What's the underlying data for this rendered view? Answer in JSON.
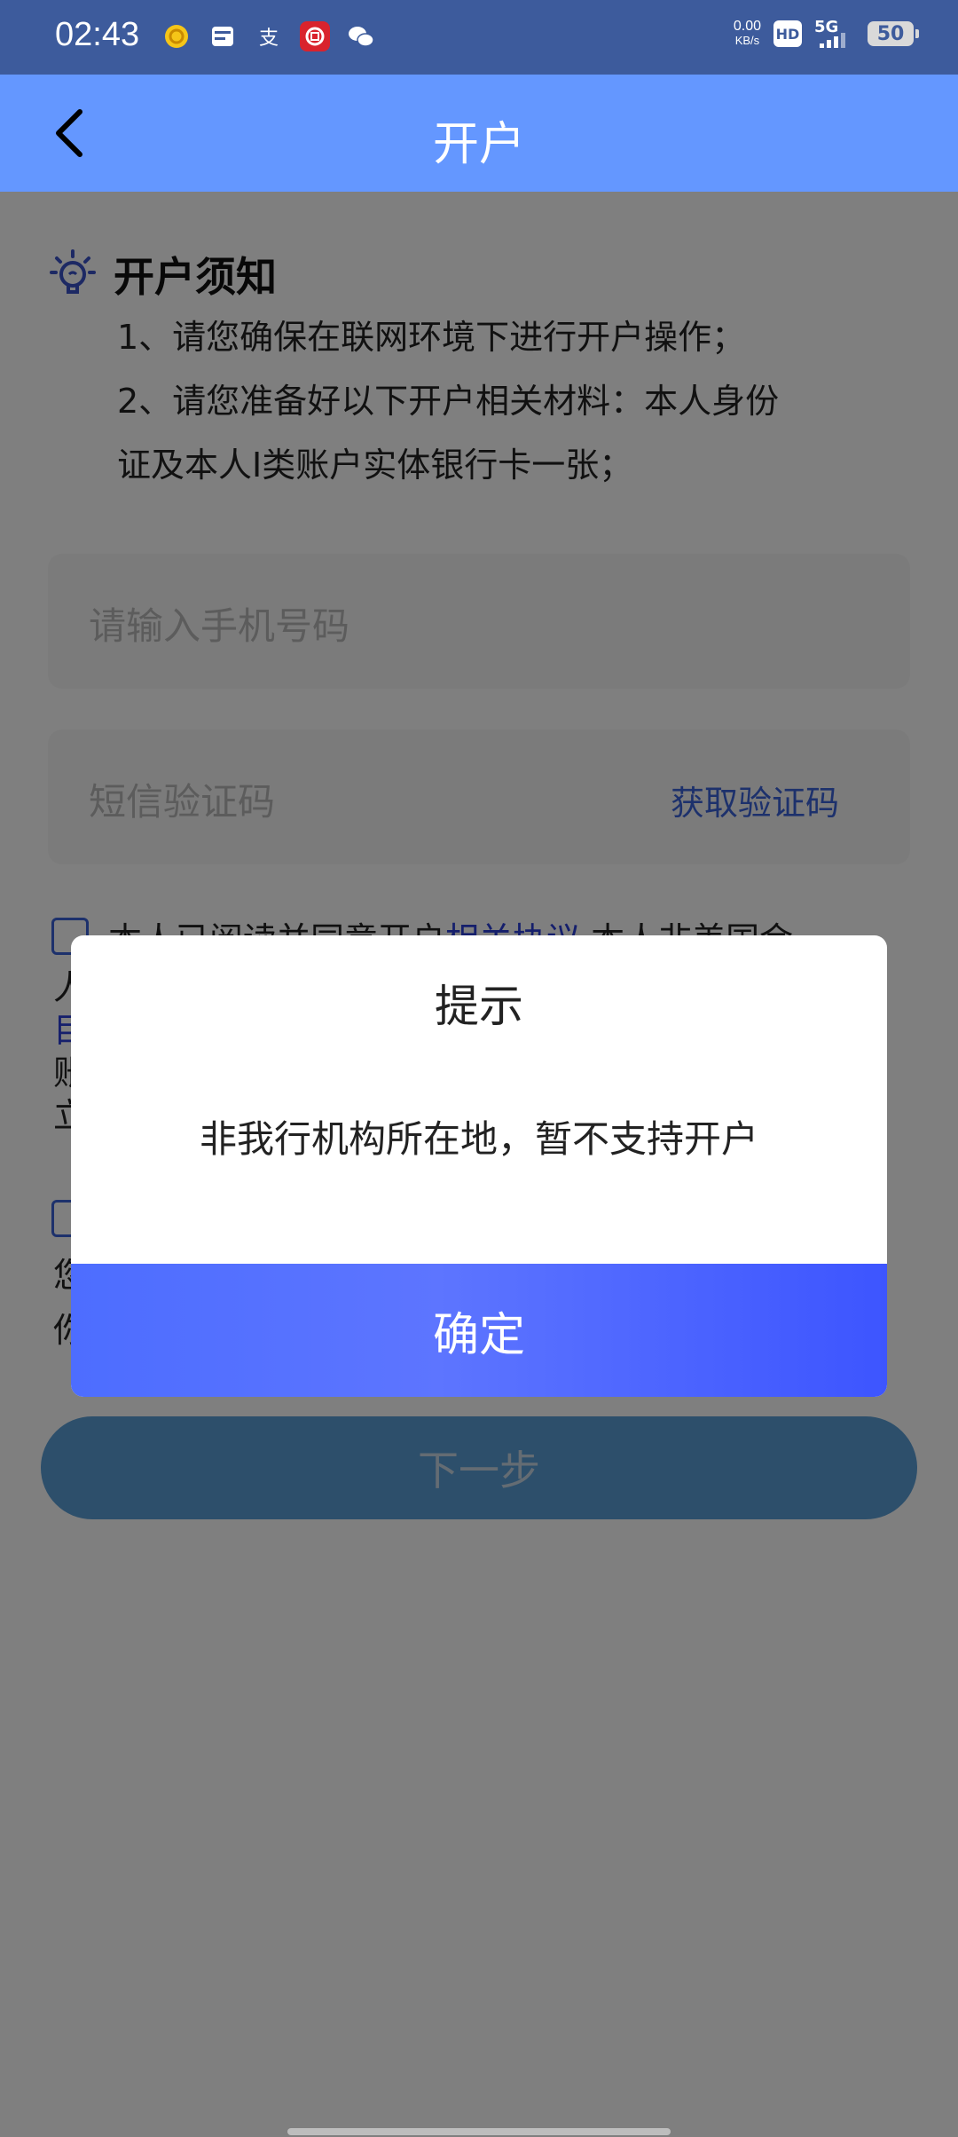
{
  "status_bar": {
    "time": "02:43",
    "net_speed_value": "0.00",
    "net_speed_unit": "KB/s",
    "hd": "HD",
    "network": "5G",
    "battery": "50",
    "notif_icons": [
      "coin-app-icon",
      "card-app-icon",
      "alipay-icon",
      "bank-app-icon",
      "wechat-icon"
    ]
  },
  "header": {
    "title": "开户"
  },
  "notice": {
    "title": "开户须知",
    "line1": "1、请您确保在联网环境下进行开户操作；",
    "line2": "2、请您准备好以下开户相关材料：本人身份",
    "line3": "证及本人I类账户实体银行卡一张；"
  },
  "form": {
    "phone_placeholder": "请输入手机号码",
    "sms_placeholder": "短信验证码",
    "get_code": "获取验证码"
  },
  "agreement": {
    "text_before": "本人已阅读并同意开户",
    "link": "相关协议",
    "text_after": ",本人非美国金",
    "frag_ren": "人",
    "frag_mu": "目",
    "frag_zhang": "账",
    "frag_li": "立",
    "frag_nin": "您",
    "frag_ni": "你"
  },
  "next_button": "下一步",
  "dialog": {
    "title": "提示",
    "message": "非我行机构所在地，暂不支持开户",
    "ok": "确定"
  }
}
